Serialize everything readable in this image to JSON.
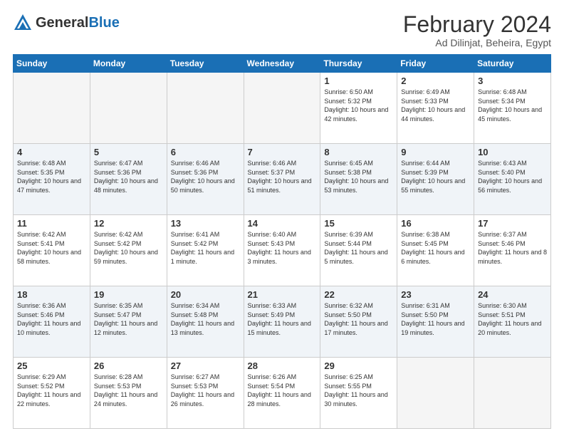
{
  "header": {
    "logo_general": "General",
    "logo_blue": "Blue",
    "month_year": "February 2024",
    "location": "Ad Dilinjat, Beheira, Egypt"
  },
  "weekdays": [
    "Sunday",
    "Monday",
    "Tuesday",
    "Wednesday",
    "Thursday",
    "Friday",
    "Saturday"
  ],
  "weeks": [
    [
      {
        "day": "",
        "sunrise": "",
        "sunset": "",
        "daylight": "",
        "empty": true
      },
      {
        "day": "",
        "sunrise": "",
        "sunset": "",
        "daylight": "",
        "empty": true
      },
      {
        "day": "",
        "sunrise": "",
        "sunset": "",
        "daylight": "",
        "empty": true
      },
      {
        "day": "",
        "sunrise": "",
        "sunset": "",
        "daylight": "",
        "empty": true
      },
      {
        "day": "1",
        "sunrise": "Sunrise: 6:50 AM",
        "sunset": "Sunset: 5:32 PM",
        "daylight": "Daylight: 10 hours and 42 minutes."
      },
      {
        "day": "2",
        "sunrise": "Sunrise: 6:49 AM",
        "sunset": "Sunset: 5:33 PM",
        "daylight": "Daylight: 10 hours and 44 minutes."
      },
      {
        "day": "3",
        "sunrise": "Sunrise: 6:48 AM",
        "sunset": "Sunset: 5:34 PM",
        "daylight": "Daylight: 10 hours and 45 minutes."
      }
    ],
    [
      {
        "day": "4",
        "sunrise": "Sunrise: 6:48 AM",
        "sunset": "Sunset: 5:35 PM",
        "daylight": "Daylight: 10 hours and 47 minutes."
      },
      {
        "day": "5",
        "sunrise": "Sunrise: 6:47 AM",
        "sunset": "Sunset: 5:36 PM",
        "daylight": "Daylight: 10 hours and 48 minutes."
      },
      {
        "day": "6",
        "sunrise": "Sunrise: 6:46 AM",
        "sunset": "Sunset: 5:36 PM",
        "daylight": "Daylight: 10 hours and 50 minutes."
      },
      {
        "day": "7",
        "sunrise": "Sunrise: 6:46 AM",
        "sunset": "Sunset: 5:37 PM",
        "daylight": "Daylight: 10 hours and 51 minutes."
      },
      {
        "day": "8",
        "sunrise": "Sunrise: 6:45 AM",
        "sunset": "Sunset: 5:38 PM",
        "daylight": "Daylight: 10 hours and 53 minutes."
      },
      {
        "day": "9",
        "sunrise": "Sunrise: 6:44 AM",
        "sunset": "Sunset: 5:39 PM",
        "daylight": "Daylight: 10 hours and 55 minutes."
      },
      {
        "day": "10",
        "sunrise": "Sunrise: 6:43 AM",
        "sunset": "Sunset: 5:40 PM",
        "daylight": "Daylight: 10 hours and 56 minutes."
      }
    ],
    [
      {
        "day": "11",
        "sunrise": "Sunrise: 6:42 AM",
        "sunset": "Sunset: 5:41 PM",
        "daylight": "Daylight: 10 hours and 58 minutes."
      },
      {
        "day": "12",
        "sunrise": "Sunrise: 6:42 AM",
        "sunset": "Sunset: 5:42 PM",
        "daylight": "Daylight: 10 hours and 59 minutes."
      },
      {
        "day": "13",
        "sunrise": "Sunrise: 6:41 AM",
        "sunset": "Sunset: 5:42 PM",
        "daylight": "Daylight: 11 hours and 1 minute."
      },
      {
        "day": "14",
        "sunrise": "Sunrise: 6:40 AM",
        "sunset": "Sunset: 5:43 PM",
        "daylight": "Daylight: 11 hours and 3 minutes."
      },
      {
        "day": "15",
        "sunrise": "Sunrise: 6:39 AM",
        "sunset": "Sunset: 5:44 PM",
        "daylight": "Daylight: 11 hours and 5 minutes."
      },
      {
        "day": "16",
        "sunrise": "Sunrise: 6:38 AM",
        "sunset": "Sunset: 5:45 PM",
        "daylight": "Daylight: 11 hours and 6 minutes."
      },
      {
        "day": "17",
        "sunrise": "Sunrise: 6:37 AM",
        "sunset": "Sunset: 5:46 PM",
        "daylight": "Daylight: 11 hours and 8 minutes."
      }
    ],
    [
      {
        "day": "18",
        "sunrise": "Sunrise: 6:36 AM",
        "sunset": "Sunset: 5:46 PM",
        "daylight": "Daylight: 11 hours and 10 minutes."
      },
      {
        "day": "19",
        "sunrise": "Sunrise: 6:35 AM",
        "sunset": "Sunset: 5:47 PM",
        "daylight": "Daylight: 11 hours and 12 minutes."
      },
      {
        "day": "20",
        "sunrise": "Sunrise: 6:34 AM",
        "sunset": "Sunset: 5:48 PM",
        "daylight": "Daylight: 11 hours and 13 minutes."
      },
      {
        "day": "21",
        "sunrise": "Sunrise: 6:33 AM",
        "sunset": "Sunset: 5:49 PM",
        "daylight": "Daylight: 11 hours and 15 minutes."
      },
      {
        "day": "22",
        "sunrise": "Sunrise: 6:32 AM",
        "sunset": "Sunset: 5:50 PM",
        "daylight": "Daylight: 11 hours and 17 minutes."
      },
      {
        "day": "23",
        "sunrise": "Sunrise: 6:31 AM",
        "sunset": "Sunset: 5:50 PM",
        "daylight": "Daylight: 11 hours and 19 minutes."
      },
      {
        "day": "24",
        "sunrise": "Sunrise: 6:30 AM",
        "sunset": "Sunset: 5:51 PM",
        "daylight": "Daylight: 11 hours and 20 minutes."
      }
    ],
    [
      {
        "day": "25",
        "sunrise": "Sunrise: 6:29 AM",
        "sunset": "Sunset: 5:52 PM",
        "daylight": "Daylight: 11 hours and 22 minutes."
      },
      {
        "day": "26",
        "sunrise": "Sunrise: 6:28 AM",
        "sunset": "Sunset: 5:53 PM",
        "daylight": "Daylight: 11 hours and 24 minutes."
      },
      {
        "day": "27",
        "sunrise": "Sunrise: 6:27 AM",
        "sunset": "Sunset: 5:53 PM",
        "daylight": "Daylight: 11 hours and 26 minutes."
      },
      {
        "day": "28",
        "sunrise": "Sunrise: 6:26 AM",
        "sunset": "Sunset: 5:54 PM",
        "daylight": "Daylight: 11 hours and 28 minutes."
      },
      {
        "day": "29",
        "sunrise": "Sunrise: 6:25 AM",
        "sunset": "Sunset: 5:55 PM",
        "daylight": "Daylight: 11 hours and 30 minutes."
      },
      {
        "day": "",
        "sunrise": "",
        "sunset": "",
        "daylight": "",
        "empty": true
      },
      {
        "day": "",
        "sunrise": "",
        "sunset": "",
        "daylight": "",
        "empty": true
      }
    ]
  ]
}
